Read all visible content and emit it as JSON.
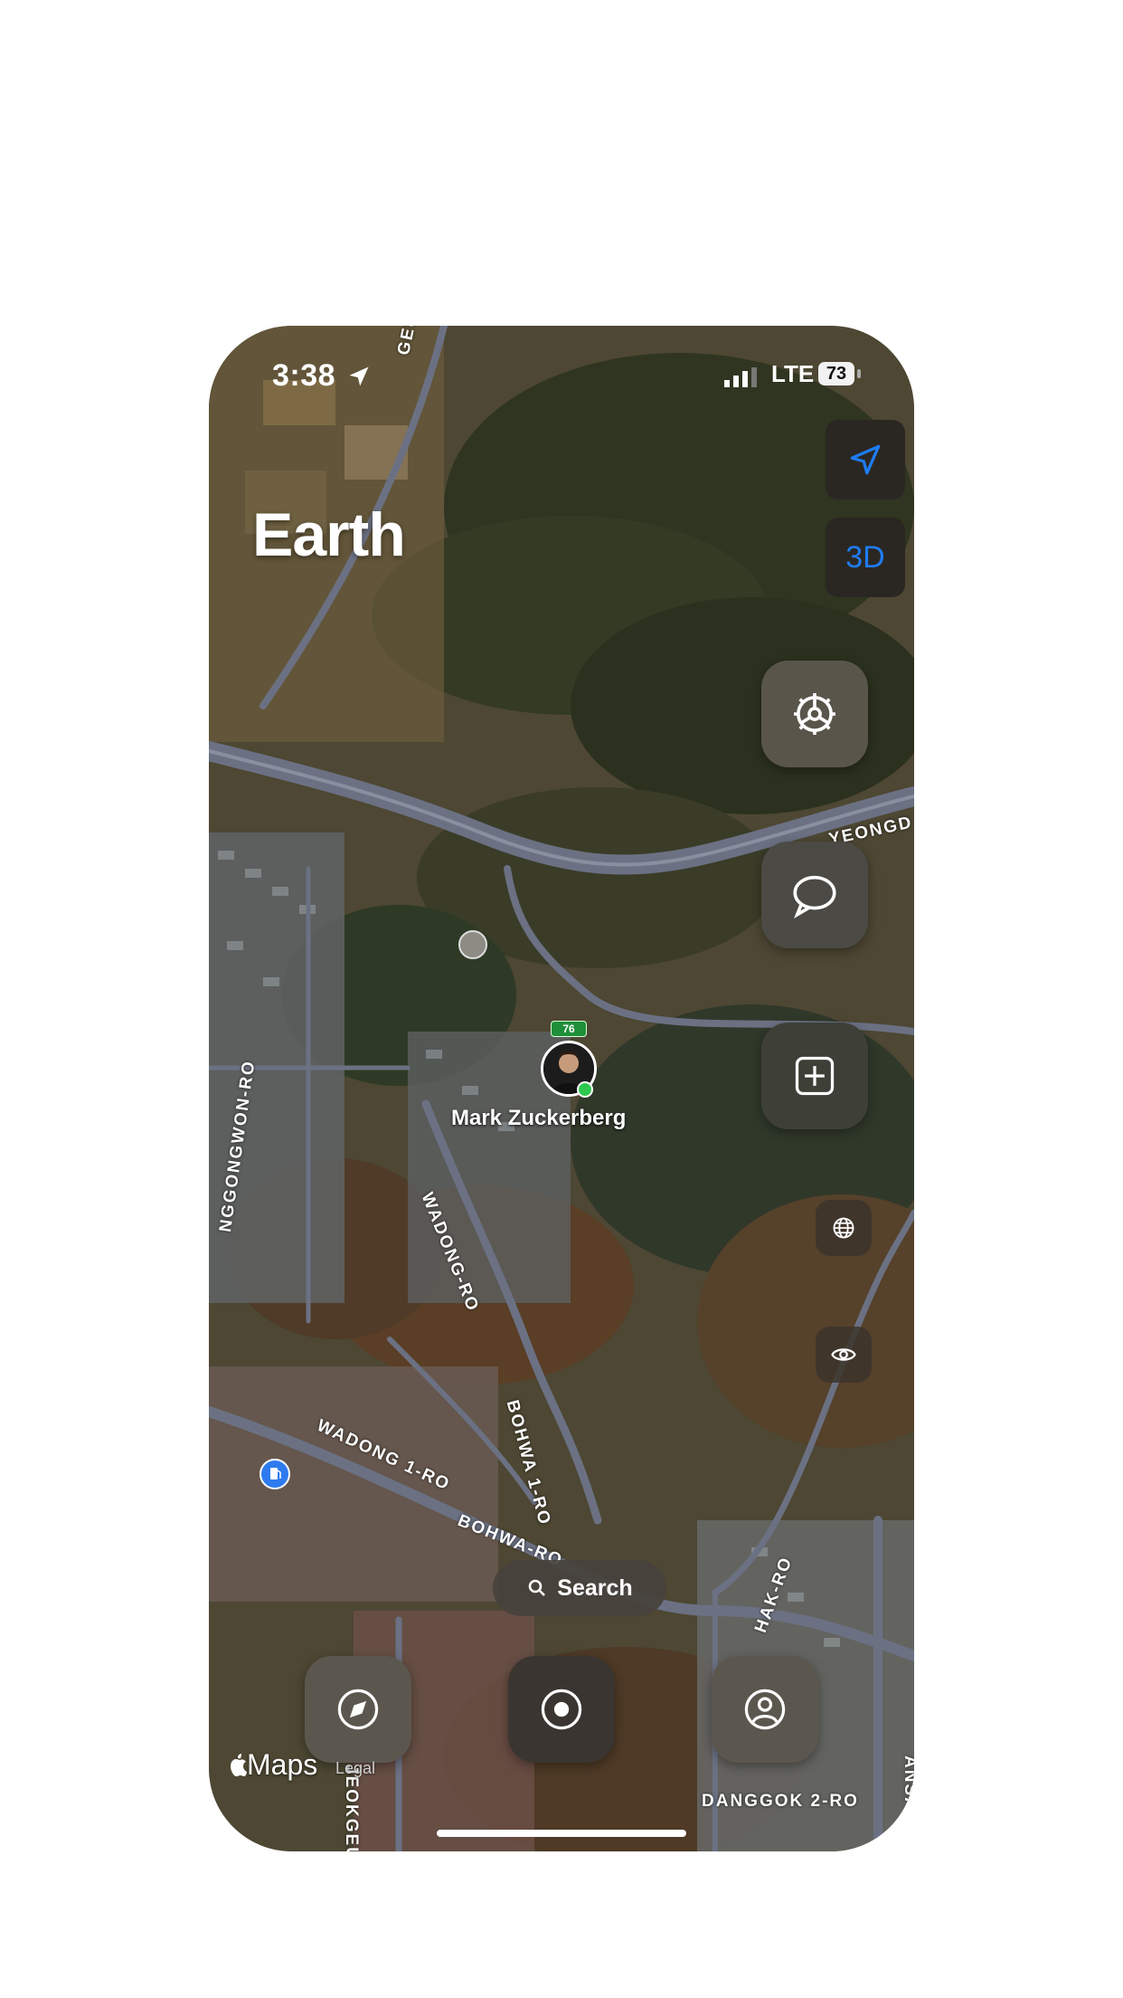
{
  "status_bar": {
    "time": "3:38",
    "network": "LTE",
    "battery": "73"
  },
  "header": {
    "title": "Earth"
  },
  "map_controls": {
    "btn_3d_label": "3D"
  },
  "map_labels": {
    "road_1": "GEUMHW",
    "road_2": "YEONGD",
    "road_3": "NGGONGWON-RO",
    "road_4": "WADONG-RO",
    "road_5": "WADONG 1-RO",
    "road_6": "BOHWA 1-RO",
    "road_7": "BOHWA-RO",
    "road_8": "HAK-RO",
    "road_9": "DANGGOK 2-RO",
    "road_10": "JEOKGEU",
    "road_11": "ANSANG"
  },
  "person": {
    "name": "Mark Zuckerberg",
    "battery": "76"
  },
  "search": {
    "label": "Search"
  },
  "footer": {
    "brand": "Maps",
    "legal": "Legal"
  },
  "colors": {
    "accent_blue": "#1e7cf2",
    "online_green": "#2dc84d"
  }
}
